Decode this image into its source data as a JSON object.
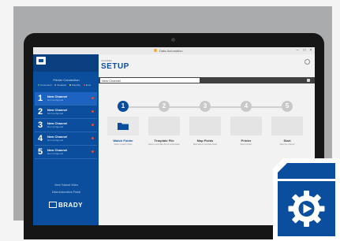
{
  "window": {
    "title": "Data Automation"
  },
  "sidebar": {
    "title": "Printer Connection",
    "legend": [
      "Connected",
      "Disabled",
      "Standby",
      "Error"
    ],
    "channels": [
      {
        "number": "1",
        "name": "New Channel",
        "status": "Not Configured"
      },
      {
        "number": "2",
        "name": "New Channel",
        "status": "Not Configured"
      },
      {
        "number": "3",
        "name": "New Channel",
        "status": "Not Configured"
      },
      {
        "number": "4",
        "name": "New Channel",
        "status": "Not Configured"
      },
      {
        "number": "5",
        "name": "New Channel",
        "status": "Not Configured"
      }
    ],
    "links": [
      "View Tutorial Video",
      "Data Automation Portal"
    ],
    "brand": "BRADY"
  },
  "main": {
    "subtitle": "CHANNEL",
    "title": "SETUP",
    "channel_name_value": "New Channel",
    "steps": [
      {
        "number": "1",
        "label": "Watch Folder",
        "desc": "Select a watch folder"
      },
      {
        "number": "2",
        "label": "Template File",
        "desc": "Select a template file for automation"
      },
      {
        "number": "3",
        "label": "Map Fields",
        "desc": "Map data to template fields"
      },
      {
        "number": "4",
        "label": "Printer",
        "desc": "Select printer"
      },
      {
        "number": "5",
        "label": "Start",
        "desc": "Start the channel"
      }
    ]
  },
  "colors": {
    "brand_blue": "#0b4e9d",
    "active_channel": "#1c64bf",
    "step_inactive": "#c9c9c9"
  }
}
